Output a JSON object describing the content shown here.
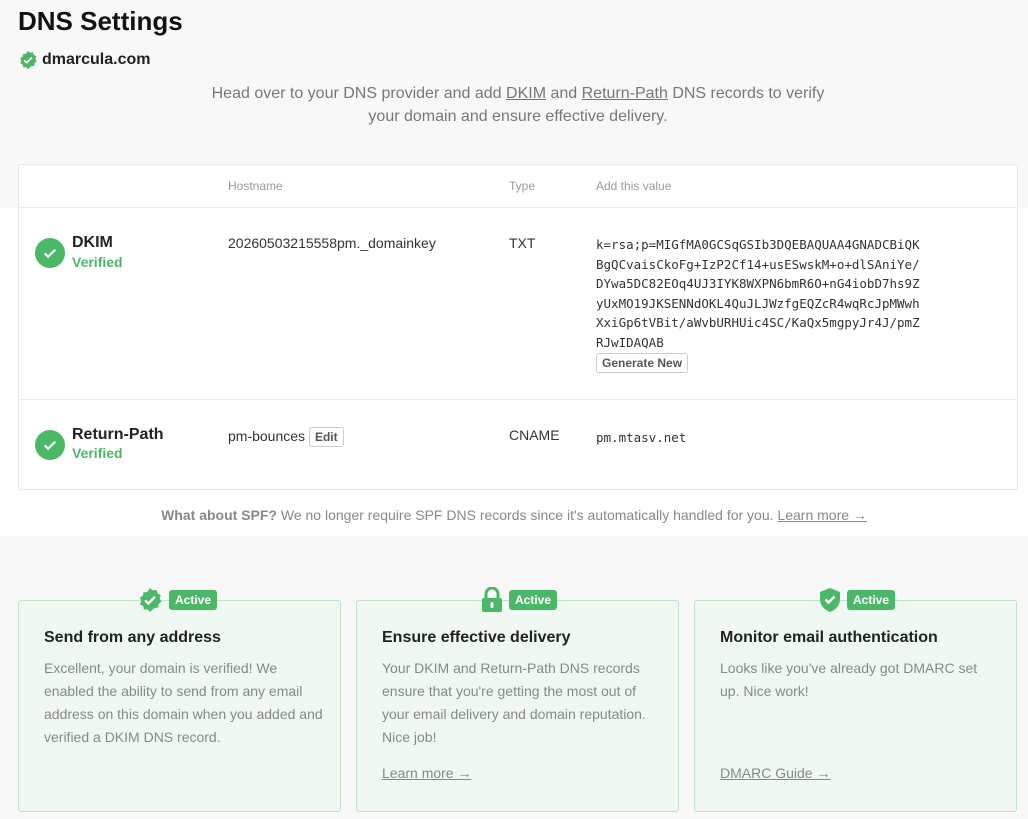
{
  "page": {
    "title": "DNS Settings",
    "domain": "dmarcula.com"
  },
  "intro": {
    "text_before": "Head over to your DNS provider and add ",
    "dkim_link": "DKIM",
    "text_and": " and ",
    "return_path_link": "Return-Path",
    "text_after": " DNS records to verify your domain and ensure effective delivery."
  },
  "records": {
    "columns": {
      "hostname": "Hostname",
      "type": "Type",
      "value": "Add this value"
    },
    "dkim": {
      "name": "DKIM",
      "status": "Verified",
      "hostname": "20260503215558pm._domainkey",
      "type": "TXT",
      "value": "k=rsa;p=MIGfMA0GCSqGSIb3DQEBAQUAA4GNADCBiQKBgQCvaisCkoFg+IzP2Cf14+usESwskM+o+dlSAniYe/DYwa5DC82EOq4UJ3IYK8WXPN6bmR6O+nG4iobD7hs9ZyUxMO19JKSENNdOKL4QuJLJWzfgEQZcR4wqRcJpMWwhXxiGp6tVBit/aWvbURHUic4SC/KaQx5mgpyJr4J/pmZRJwIDAQAB",
      "generate_label": "Generate New"
    },
    "return_path": {
      "name": "Return-Path",
      "status": "Verified",
      "hostname": "pm-bounces",
      "edit_label": "Edit",
      "type": "CNAME",
      "value": "pm.mtasv.net"
    }
  },
  "spf": {
    "question": "What about SPF?",
    "text": " We no longer require SPF DNS records since it's automatically handled for you. ",
    "link": "Learn more →"
  },
  "cards": [
    {
      "badge": "Active",
      "icon": "verified-badge-icon",
      "title": "Send from any address",
      "body": "Excellent, your domain is verified! We enabled the ability to send from any email address on this domain when you added and verified a DKIM DNS record.",
      "link": ""
    },
    {
      "badge": "Active",
      "icon": "lock-icon",
      "title": "Ensure effective delivery",
      "body": "Your DKIM and Return-Path DNS records ensure that you're getting the most out of your email delivery and domain reputation. Nice job!",
      "link": "Learn more →"
    },
    {
      "badge": "Active",
      "icon": "shield-check-icon",
      "title": "Monitor email authentication",
      "body": "Looks like you've already got DMARC set up. Nice work!",
      "link": "DMARC Guide →"
    }
  ],
  "colors": {
    "accent": "#4bb868",
    "card_bg": "#f0f8f2",
    "card_border": "#bfe2c9"
  }
}
